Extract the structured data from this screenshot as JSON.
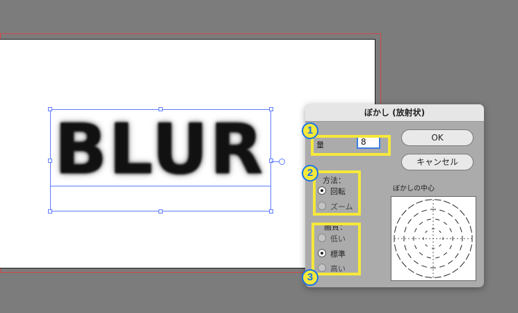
{
  "canvas": {
    "text": "BLUR"
  },
  "dialog": {
    "title": "ぼかし (放射状)",
    "amount_label": "量",
    "amount_value": "8",
    "ok_label": "OK",
    "cancel_label": "キャンセル",
    "method": {
      "label": "方法：",
      "options": [
        {
          "label": "回転",
          "selected": true
        },
        {
          "label": "ズーム",
          "selected": false
        }
      ]
    },
    "quality": {
      "label": "画質：",
      "options": [
        {
          "label": "低い",
          "selected": false
        },
        {
          "label": "標準",
          "selected": true
        },
        {
          "label": "高い",
          "selected": false
        }
      ]
    },
    "center_label": "ぼかしの中心"
  },
  "annotations": {
    "badges": [
      "1",
      "2",
      "3"
    ],
    "highlight_color": "#f6e83a",
    "badge_text_color": "#1a73e8"
  }
}
